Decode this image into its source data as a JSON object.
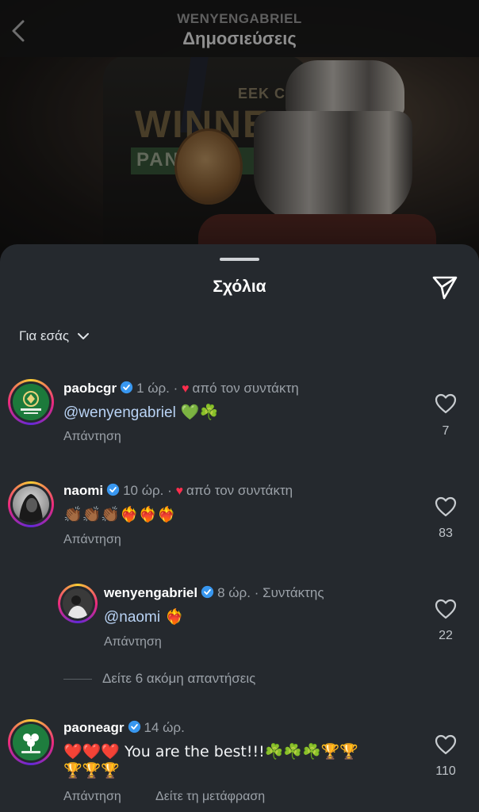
{
  "header": {
    "username": "WENYENGABRIEL",
    "title": "Δημοσιεύσεις"
  },
  "post_image": {
    "shirt_line1": "EEK CU",
    "shirt_line2": "WINNE",
    "shirt_line3": "PAN   NAIK"
  },
  "sheet": {
    "title": "Σχόλια",
    "filter_label": "Για εσάς"
  },
  "comments": [
    {
      "username": "paobcgr",
      "time": "1 ώρ.",
      "author_liked_label": "από τον συντάκτη",
      "text_mention": "@wenyengabriel",
      "text_rest": " 💚☘️",
      "reply_label": "Απάντηση",
      "likes": "7"
    },
    {
      "username": "naomi",
      "time": "10 ώρ.",
      "author_liked_label": "από τον συντάκτη",
      "text": "👏🏾👏🏾👏🏾❤️‍🔥❤️‍🔥❤️‍🔥",
      "reply_label": "Απάντηση",
      "likes": "83"
    },
    {
      "username": "wenyengabriel",
      "time": "8 ώρ.",
      "role": "Συντάκτης",
      "text_mention": "@naomi",
      "text_rest": " ❤️‍🔥",
      "reply_label": "Απάντηση",
      "likes": "22"
    },
    {
      "username": "paoneagr",
      "time": "14 ώρ.",
      "text_line1": "❤️❤️❤️ You are the best!!!☘️☘️☘️🏆🏆",
      "text_line2": "🏆🏆🏆",
      "reply_label": "Απάντηση",
      "translate_label": "Δείτε τη μετάφραση",
      "likes": "110"
    }
  ],
  "more_replies_label": "Δείτε 6 ακόμη απαντήσεις",
  "colors": {
    "sheet_bg": "#25292e",
    "verified_blue": "#3897f0",
    "heart_red": "#ff2e4d",
    "mention_blue": "#b9d3f5"
  }
}
